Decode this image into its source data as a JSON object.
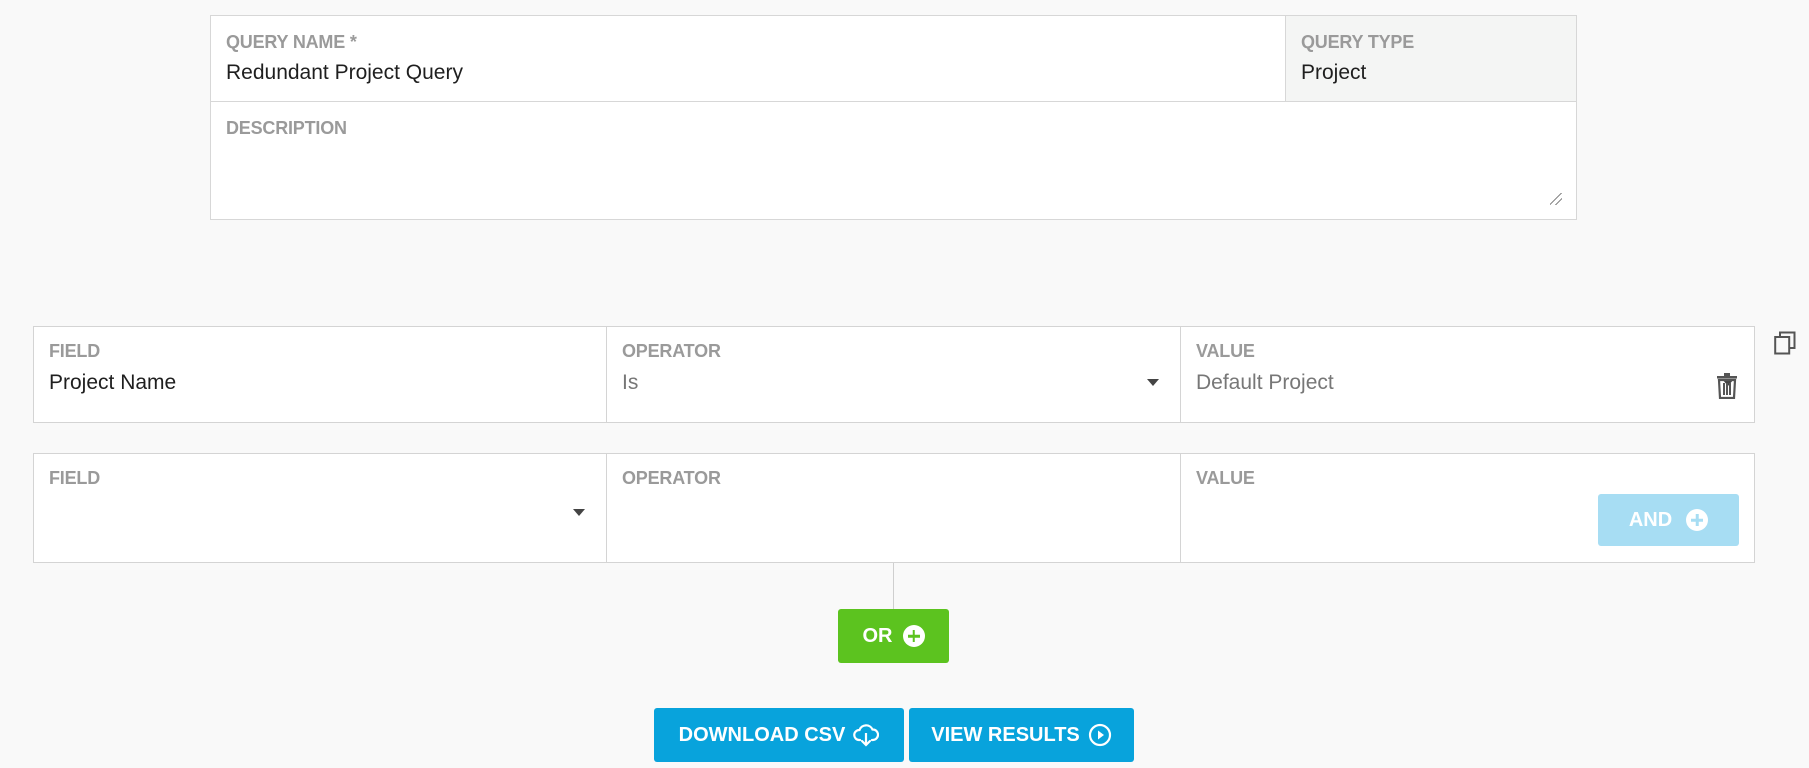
{
  "query": {
    "name_label": "QUERY NAME *",
    "name_value": "Redundant Project Query",
    "type_label": "QUERY TYPE",
    "type_value": "Project",
    "description_label": "DESCRIPTION",
    "description_value": ""
  },
  "rules": [
    {
      "field_label": "FIELD",
      "field_value": "Project Name",
      "operator_label": "OPERATOR",
      "operator_value": "Is",
      "value_label": "VALUE",
      "value_value": "Default Project"
    },
    {
      "field_label": "FIELD",
      "field_value": "",
      "operator_label": "OPERATOR",
      "operator_value": "",
      "value_label": "VALUE",
      "value_value": ""
    }
  ],
  "buttons": {
    "and_label": "AND",
    "or_label": "OR",
    "download_label": "DOWNLOAD CSV",
    "view_label": "VIEW RESULTS"
  },
  "colors": {
    "and_button": "#a7ddf3",
    "or_button": "#5cc31f",
    "primary_button": "#08a3dc"
  },
  "icons": {
    "copy": "copy-icon",
    "trash": "trash-icon",
    "plus": "plus-circle-icon",
    "download": "cloud-download-icon",
    "play": "play-circle-icon"
  }
}
